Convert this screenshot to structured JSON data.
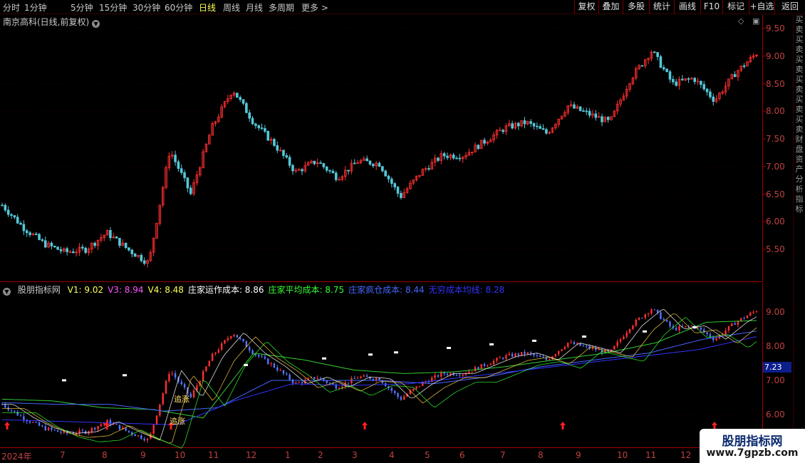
{
  "toolbar": {
    "periods": [
      {
        "label": "分时",
        "x": 4
      },
      {
        "label": "1分钟",
        "x": 34
      },
      {
        "label": "5分钟",
        "x": 99
      },
      {
        "label": "15分钟",
        "x": 139
      },
      {
        "label": "30分钟",
        "x": 186
      },
      {
        "label": "60分钟",
        "x": 231
      },
      {
        "label": "日线",
        "x": 279,
        "active": true
      },
      {
        "label": "周线",
        "x": 313
      },
      {
        "label": "月线",
        "x": 345
      },
      {
        "label": "多周期",
        "x": 377
      },
      {
        "label": "更多",
        "x": 423
      }
    ],
    "tools": [
      "复权",
      "叠加",
      "多股",
      "统计",
      "画线",
      "F10",
      "标记",
      "+自选",
      "返回"
    ]
  },
  "main": {
    "title": "南京高科(日线,前复权)",
    "y_ticks": [
      "9.50",
      "9.00",
      "8.50",
      "8.00",
      "7.50",
      "7.00",
      "6.50",
      "6.00",
      "5.50"
    ]
  },
  "indicator": {
    "name": "股朋指标网",
    "values": [
      {
        "label": "V1: 9.02",
        "color": "#ffff55"
      },
      {
        "label": "V3: 8.94",
        "color": "#ff55ff"
      },
      {
        "label": "V4: 8.48",
        "color": "#ffff55"
      },
      {
        "label": "庄家运作成本: 8.86",
        "color": "#ffffff"
      },
      {
        "label": "庄家平均成本: 8.75",
        "color": "#33ff33"
      },
      {
        "label": "庄家疯仓成本: 8.44",
        "color": "#4466ff"
      },
      {
        "label": "无穷成本均线: 8.28",
        "color": "#3333ff"
      }
    ],
    "y_ticks": [
      "9.00",
      "8.00",
      "7.00",
      "6.00"
    ],
    "current_value": "7.23",
    "annotations": [
      "追涨",
      "追涨"
    ]
  },
  "x_axis": [
    "2024年",
    "7",
    "8",
    "9",
    "10",
    "11",
    "12",
    "1",
    "2",
    "3",
    "4",
    "5",
    "6",
    "7",
    "8",
    "9",
    "10",
    "11",
    "12"
  ],
  "watermark": {
    "title": "股朋指标网",
    "url": "www.7gpzb.com"
  },
  "side_strip": "买卖买卖买卖买卖买卖买卖财盘资产分析指标",
  "chart_data": {
    "type": "candlestick",
    "title": "南京高科(日线,前复权)",
    "ylim": [
      5.1,
      9.6
    ],
    "close_series": [
      {
        "date": "2024-06",
        "close": 6.3
      },
      {
        "date": "2024-06",
        "close": 5.9
      },
      {
        "date": "2024-07",
        "close": 5.6
      },
      {
        "date": "2024-07",
        "close": 5.45
      },
      {
        "date": "2024-08",
        "close": 5.5
      },
      {
        "date": "2024-08",
        "close": 5.8
      },
      {
        "date": "2024-09",
        "close": 5.5
      },
      {
        "date": "2024-09",
        "close": 5.25
      },
      {
        "date": "2024-10",
        "close": 7.3
      },
      {
        "date": "2024-10",
        "close": 6.5
      },
      {
        "date": "2024-11",
        "close": 7.7
      },
      {
        "date": "2024-11",
        "close": 8.4
      },
      {
        "date": "2024-12",
        "close": 7.8
      },
      {
        "date": "2024-12",
        "close": 7.4
      },
      {
        "date": "2025-01",
        "close": 6.9
      },
      {
        "date": "2025-01",
        "close": 7.1
      },
      {
        "date": "2025-02",
        "close": 6.8
      },
      {
        "date": "2025-03",
        "close": 7.1
      },
      {
        "date": "2025-03",
        "close": 7.05
      },
      {
        "date": "2025-04",
        "close": 6.45
      },
      {
        "date": "2025-04",
        "close": 6.9
      },
      {
        "date": "2025-05",
        "close": 7.2
      },
      {
        "date": "2025-06",
        "close": 7.2
      },
      {
        "date": "2025-06",
        "close": 7.45
      },
      {
        "date": "2025-07",
        "close": 7.7
      },
      {
        "date": "2025-08",
        "close": 7.8
      },
      {
        "date": "2025-08",
        "close": 7.6
      },
      {
        "date": "2025-09",
        "close": 8.1
      },
      {
        "date": "2025-09",
        "close": 7.95
      },
      {
        "date": "2025-10",
        "close": 7.8
      },
      {
        "date": "2025-10",
        "close": 8.6
      },
      {
        "date": "2025-11",
        "close": 9.1
      },
      {
        "date": "2025-11",
        "close": 8.5
      },
      {
        "date": "2025-12",
        "close": 8.6
      },
      {
        "date": "2025-12",
        "close": 8.2
      },
      {
        "date": "2026-01",
        "close": 8.7
      },
      {
        "date": "2026-01",
        "close": 9.05
      }
    ],
    "indicator_lines": [
      {
        "name": "庄家平均成本",
        "color": "#33cc33",
        "values": [
          6.45,
          6.4,
          6.2,
          6.15,
          5.9,
          7.8,
          7.6,
          7.3,
          7.2,
          7.25,
          7.4,
          7.6,
          7.8,
          8.1,
          8.7,
          8.75
        ]
      },
      {
        "name": "庄家疯仓成本",
        "color": "#4466ff",
        "values": [
          6.35,
          6.3,
          6.3,
          6.1,
          6.2,
          7.0,
          7.0,
          7.0,
          6.9,
          7.1,
          7.4,
          7.6,
          7.8,
          8.2,
          8.44
        ]
      },
      {
        "name": "无穷成本均线",
        "color": "#3333ff",
        "values": [
          5.85,
          5.8,
          5.75,
          5.7,
          6.4,
          6.9,
          6.85,
          6.9,
          7.1,
          7.3,
          7.5,
          7.7,
          7.9,
          8.28
        ]
      }
    ]
  }
}
